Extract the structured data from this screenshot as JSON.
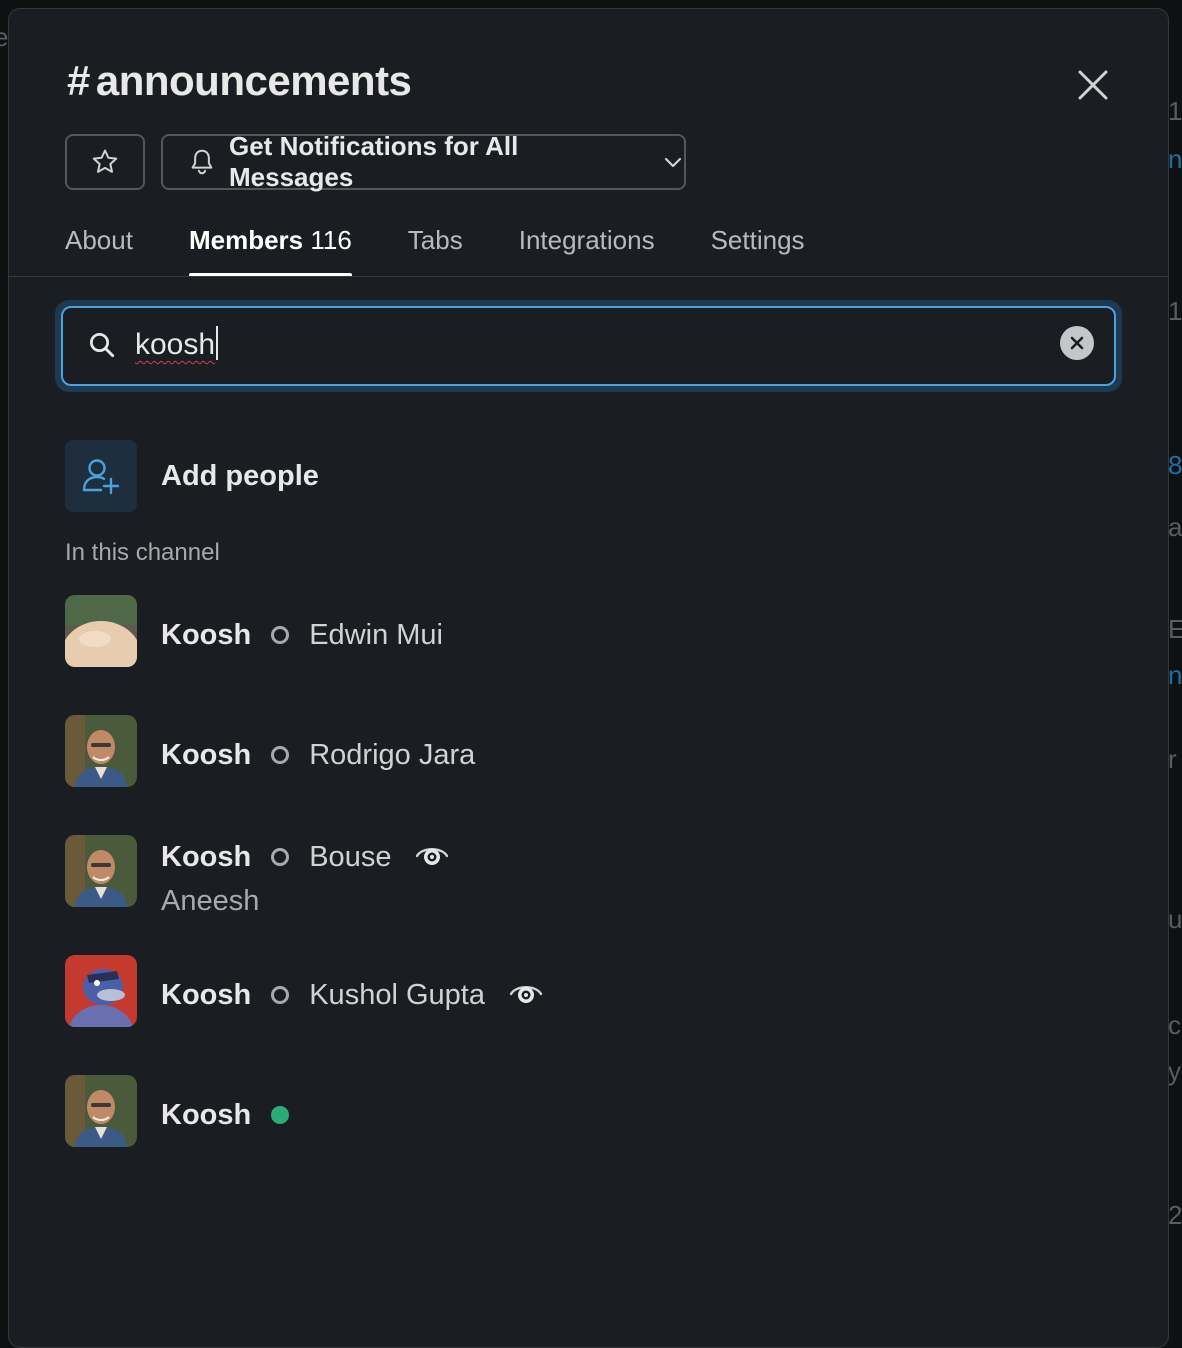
{
  "channel": {
    "hash": "#",
    "name": "announcements"
  },
  "icons": {
    "close": "close-icon",
    "star": "star-icon",
    "bell": "bell-icon",
    "chevron": "chevron-down-icon",
    "search": "search-icon",
    "clear": "clear-icon",
    "add_people": "add-user-icon",
    "eye": "eye-icon"
  },
  "notifications": {
    "label": "Get Notifications for All Messages"
  },
  "tabs": [
    {
      "label": "About"
    },
    {
      "label": "Members",
      "count": "116",
      "active": true
    },
    {
      "label": "Tabs"
    },
    {
      "label": "Integrations"
    },
    {
      "label": "Settings"
    }
  ],
  "search": {
    "value": "koosh"
  },
  "add_people": {
    "label": "Add people"
  },
  "section": {
    "label": "In this channel"
  },
  "members": [
    {
      "display": "Koosh",
      "real": "Edwin Mui",
      "status": "away"
    },
    {
      "display": "Koosh",
      "real": "Rodrigo Jara",
      "status": "away"
    },
    {
      "display": "Koosh",
      "real": "Bouse",
      "real_cont": "Aneesh",
      "status": "away",
      "eye": true
    },
    {
      "display": "Koosh",
      "real": "Kushol Gupta",
      "status": "away",
      "eye": true
    },
    {
      "display": "Koosh",
      "real": "",
      "status": "active"
    }
  ],
  "colors": {
    "accent": "#4aa3df",
    "active": "#2bac76",
    "background": "#1a1d21"
  },
  "background_fragments": [
    "e",
    "1",
    "n",
    "1",
    "8",
    "a",
    "E",
    "n",
    "r",
    "u",
    "c",
    "y:",
    "2"
  ]
}
